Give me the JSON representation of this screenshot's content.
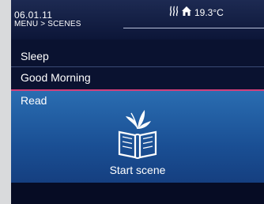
{
  "status": {
    "date": "06.01.11",
    "breadcrumb": "MENU > SCENES",
    "temperature": "19.3°C"
  },
  "scenes": {
    "items": [
      {
        "label": "Sleep",
        "selected": false
      },
      {
        "label": "Good Morning",
        "selected": false
      },
      {
        "label": "Read",
        "selected": true
      }
    ],
    "selected_action": "Start scene",
    "selected_icon": "book-icon"
  },
  "colors": {
    "background": "#0a1230",
    "selection": "#2a6db1",
    "divider": "#d2407a",
    "text": "#ffffff"
  }
}
